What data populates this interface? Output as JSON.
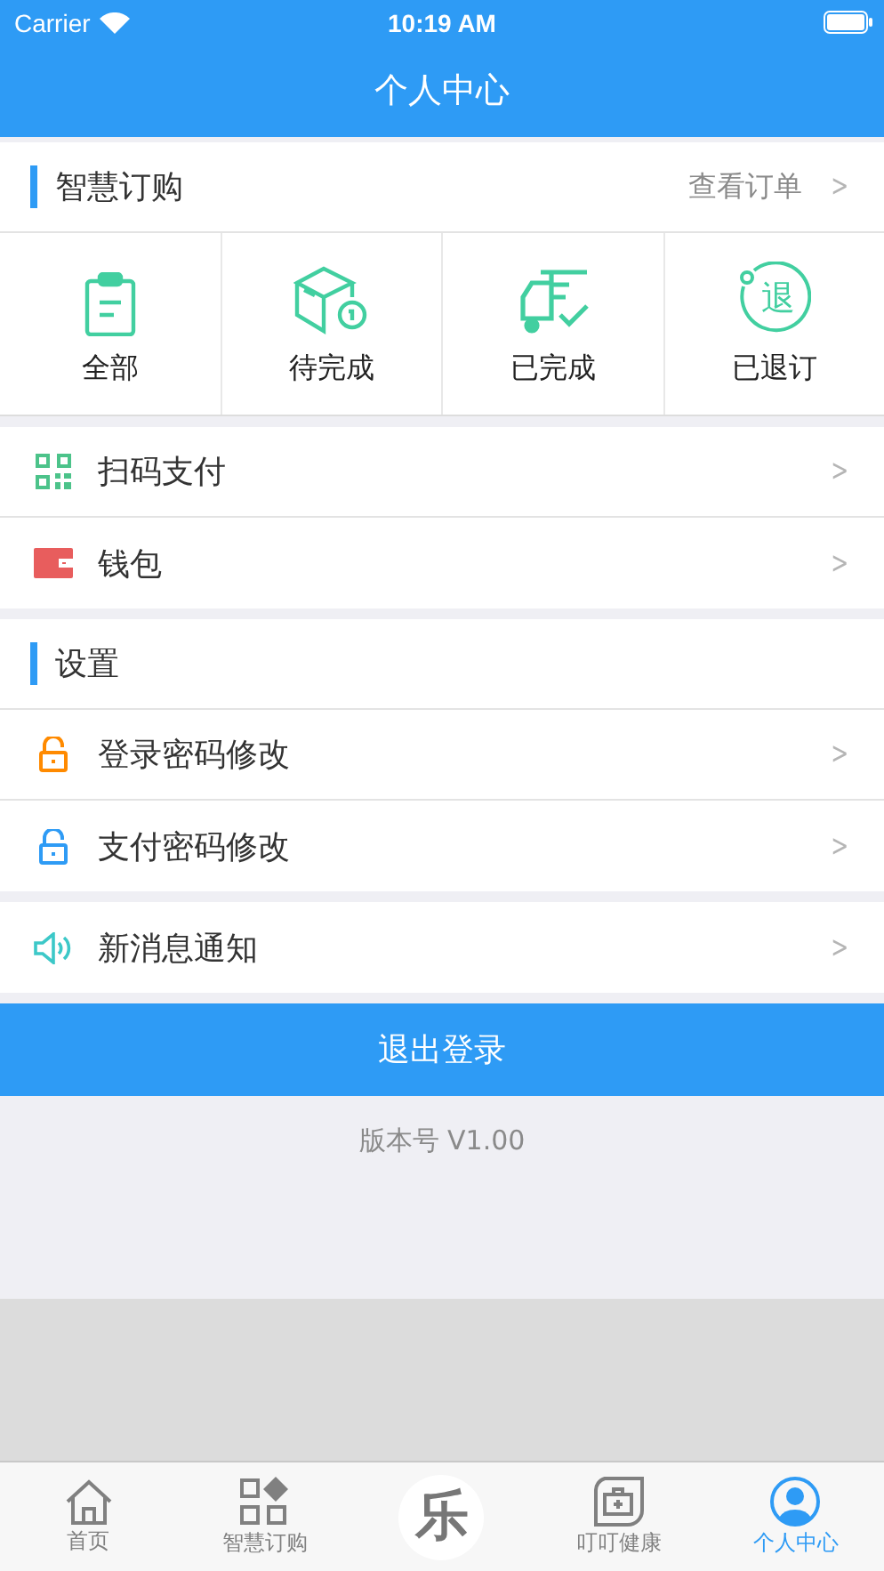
{
  "status_bar": {
    "carrier": "Carrier",
    "time": "10:19 AM"
  },
  "nav": {
    "title": "个人中心"
  },
  "orders": {
    "title": "智慧订购",
    "link": "查看订单",
    "link_arrow": ">",
    "items": [
      {
        "label": "全部",
        "kind": "clipboard"
      },
      {
        "label": "待完成",
        "kind": "box"
      },
      {
        "label": "已完成",
        "kind": "truck"
      },
      {
        "label": "已退订",
        "kind": "refund",
        "glyph": "退"
      }
    ]
  },
  "pay_items": [
    {
      "label": "扫码支付",
      "kind": "qr",
      "color": "#4cc38a",
      "arrow": ">"
    },
    {
      "label": "钱包",
      "kind": "wallet",
      "color": "#e85d5d",
      "arrow": ">"
    }
  ],
  "settings": {
    "title": "设置",
    "items": [
      {
        "label": "登录密码修改",
        "kind": "lock",
        "color": "#ff8a00",
        "arrow": ">"
      },
      {
        "label": "支付密码修改",
        "kind": "lock",
        "color": "#2e9bf5",
        "arrow": ">"
      }
    ]
  },
  "notify_items": [
    {
      "label": "新消息通知",
      "kind": "speaker",
      "color": "#3cc8c8",
      "arrow": ">"
    }
  ],
  "logout": "退出登录",
  "version": "版本号 V1.00",
  "tab_bar": [
    {
      "label": "首页",
      "kind": "home",
      "selected": false
    },
    {
      "label": "智慧订购",
      "kind": "grid",
      "selected": false
    },
    {
      "label": "乐",
      "kind": "center",
      "selected": false
    },
    {
      "label": "叮叮健康",
      "kind": "health",
      "selected": false
    },
    {
      "label": "个人中心",
      "kind": "user",
      "selected": true
    }
  ]
}
